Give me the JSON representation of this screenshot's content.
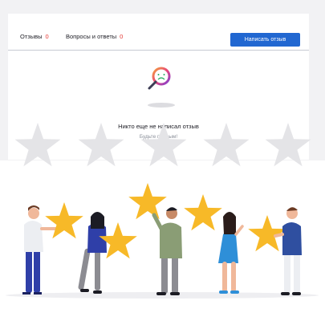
{
  "tabs": [
    {
      "label": "Отзывы",
      "count": "0"
    },
    {
      "label": "Вопросы и ответы",
      "count": "0"
    }
  ],
  "write_review_button": "Написать отзыв",
  "empty_state": {
    "title": "Никто еще не написал отзыв",
    "subtitle": "Будьте первым!"
  },
  "colors": {
    "accent": "#2167d1",
    "count": "#e53935",
    "star_gray": "#e4e4e7",
    "star_gold": "#f7b928"
  },
  "icons": {
    "empty": "magnifier-sad-icon"
  }
}
